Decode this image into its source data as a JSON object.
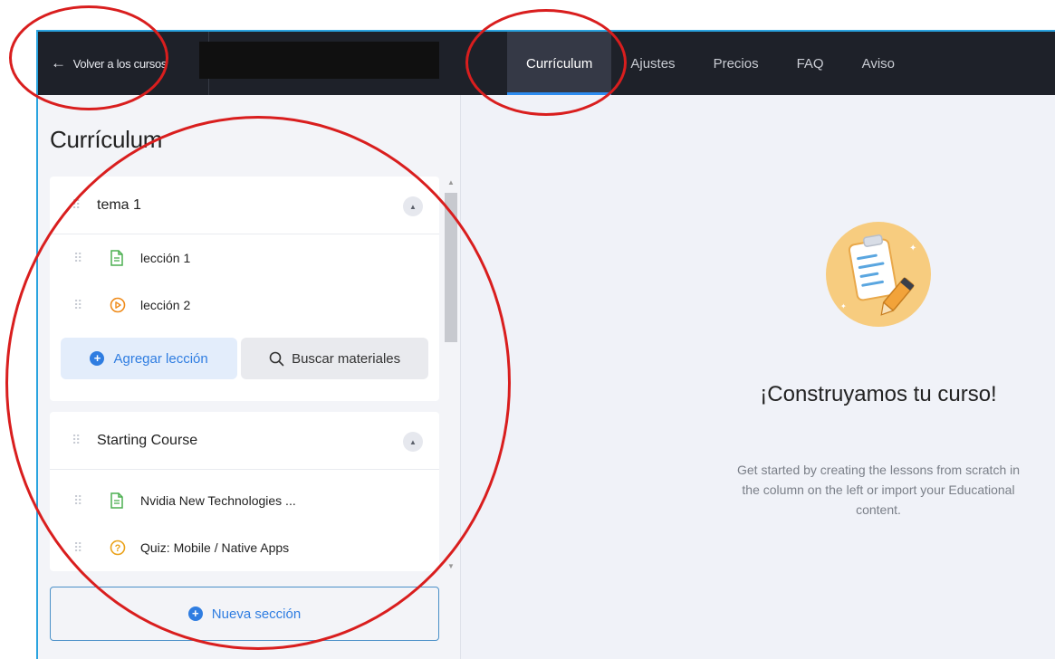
{
  "topbar": {
    "back_label": "Volver a los cursos",
    "tabs": [
      {
        "label": "Currículum",
        "active": true
      },
      {
        "label": "Ajustes"
      },
      {
        "label": "Precios"
      },
      {
        "label": "FAQ"
      },
      {
        "label": "Aviso"
      }
    ]
  },
  "sidebar": {
    "title": "Currículum",
    "sections": [
      {
        "title": "tema 1",
        "lessons": [
          {
            "label": "lección 1",
            "icon": "document-icon"
          },
          {
            "label": "lección 2",
            "icon": "video-play-icon"
          }
        ],
        "add_lesson_label": "Agregar lección",
        "search_materials_label": "Buscar materiales"
      },
      {
        "title": "Starting Course",
        "lessons": [
          {
            "label": "Nvidia New Technologies ...",
            "icon": "document-icon"
          },
          {
            "label": "Quiz: Mobile / Native Apps",
            "icon": "quiz-icon"
          }
        ]
      }
    ],
    "new_section_label": "Nueva sección"
  },
  "main": {
    "empty_title": "¡Construyamos tu curso!",
    "empty_description": "Get started by creating the lessons from scratch in the column on the left or import your Educational content."
  },
  "colors": {
    "accent": "#2f7de1",
    "topbar_bg": "#1e2129",
    "annotation_red": "#d91e1e",
    "illustration_bg": "#f7cc7f"
  }
}
